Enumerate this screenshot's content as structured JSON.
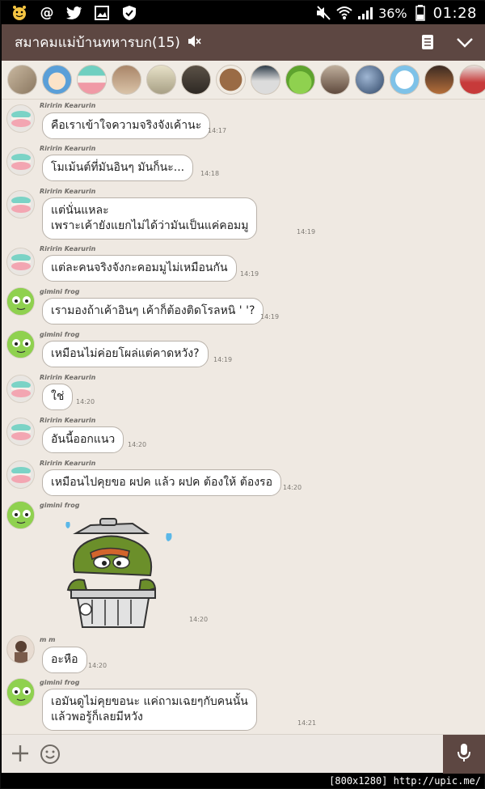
{
  "status_bar": {
    "battery": "36%",
    "time": "01:28"
  },
  "header": {
    "title": "สมาคมแม่บ้านทหารบก(15)"
  },
  "members": [
    "cat",
    "finn",
    "macaron",
    "cap",
    "nature",
    "animal",
    "bear",
    "desk",
    "frog",
    "girl",
    "storm",
    "cartoon",
    "cafe",
    "red"
  ],
  "messages": [
    {
      "sender": "Riririn Kearurin",
      "avatar": "macaron",
      "text": "คือเราเข้าใจความจริงจังเค้านะ",
      "time": "14:17"
    },
    {
      "sender": "Riririn Kearurin",
      "avatar": "macaron",
      "text": "โมเม้นต์ที่มันอินๆ มันก็นะ...",
      "time": "14:18"
    },
    {
      "sender": "Riririn Kearurin",
      "avatar": "macaron",
      "text": "แต่นั่นแหละ\nเพราะเค้ายังแยกไม่ได้ว่ามันเป็นแค่คอมมู",
      "time": "14:19"
    },
    {
      "sender": "Riririn Kearurin",
      "avatar": "macaron",
      "text": "แต่ละคนจริงจังกะคอมมูไม่เหมือนกัน",
      "time": "14:19"
    },
    {
      "sender": "gimini frog",
      "avatar": "frog",
      "text": "เรามองถ้าเค้าอินๆ เค้าก็ต้องติดโรลหนิ ' '?",
      "time": "14:19"
    },
    {
      "sender": "gimini frog",
      "avatar": "frog",
      "text": "เหมือนไม่ค่อยโผล่แต่คาดหวัง?",
      "time": "14:19"
    },
    {
      "sender": "Riririn Kearurin",
      "avatar": "macaron",
      "text": "ใช่",
      "time": "14:20"
    },
    {
      "sender": "Riririn Kearurin",
      "avatar": "macaron",
      "text": "อันนี้ออกแนว",
      "time": "14:20"
    },
    {
      "sender": "Riririn Kearurin",
      "avatar": "macaron",
      "text": "เหมือนไปคุยขอ ผปค แล้ว ผปค ต้องให้ ต้องรอ",
      "time": "14:20"
    },
    {
      "sender": "gimini frog",
      "avatar": "frog",
      "sticker": "grouch-in-trashcan",
      "time": "14:20"
    },
    {
      "sender": "m m",
      "avatar": "mm",
      "text": "อะหือ",
      "time": "14:20"
    },
    {
      "sender": "gimini frog",
      "avatar": "frog",
      "text": "เอมันดูไม่คุยขอนะ แค่ถามเฉยๆกับคนนั้น\nแล้วพอรู้ก็เลยมีหวัง",
      "time": "14:21"
    }
  ],
  "footer": "[800x1280] http://upic.me/"
}
